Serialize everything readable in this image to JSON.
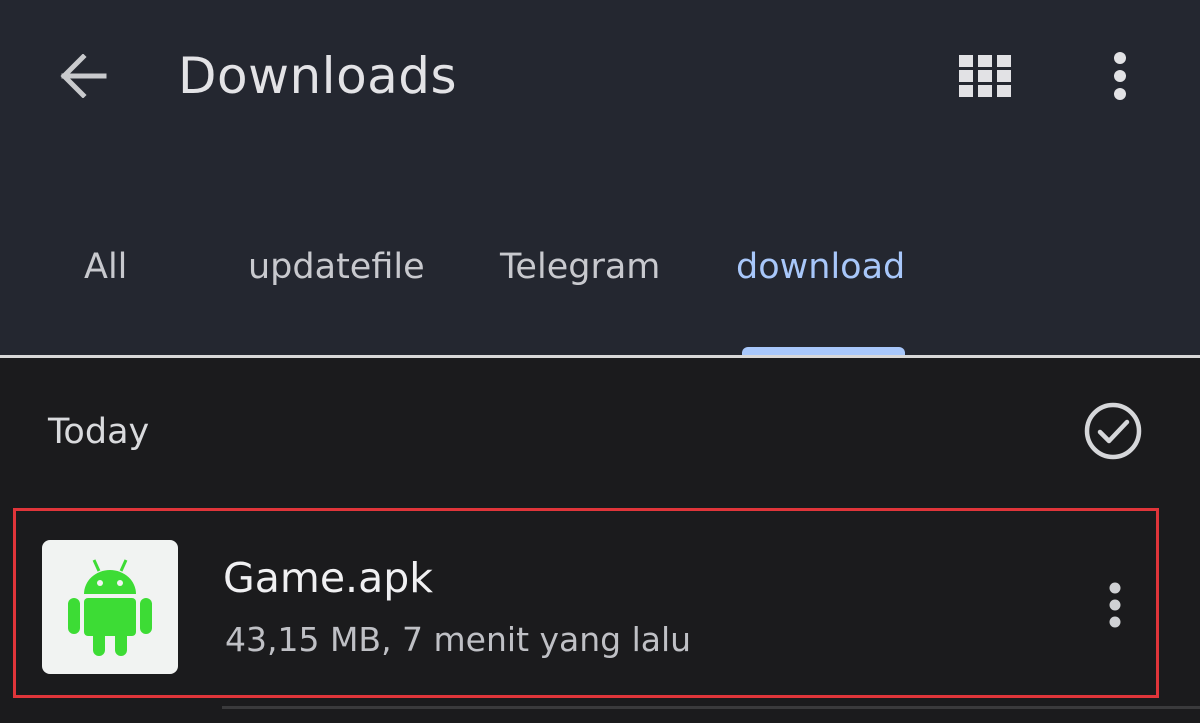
{
  "header": {
    "title": "Downloads",
    "back_icon": "arrow-left-icon",
    "grid_icon": "grid-view-icon",
    "more_icon": "more-vert-icon"
  },
  "tabs": [
    {
      "label": "All",
      "active": false
    },
    {
      "label": "updatefile",
      "active": false
    },
    {
      "label": "Telegram",
      "active": false
    },
    {
      "label": "download",
      "active": true
    }
  ],
  "section": {
    "title": "Today",
    "select_icon": "check-circle-icon"
  },
  "files": [
    {
      "name": "Game.apk",
      "meta": "43,15 MB, 7 menit yang lalu",
      "icon": "android-icon",
      "highlighted": true
    }
  ],
  "colors": {
    "header_bg": "#242730",
    "content_bg": "#1b1b1d",
    "accent": "#a8c7fa",
    "highlight_border": "#e0353a",
    "android_green": "#3ddc35"
  }
}
